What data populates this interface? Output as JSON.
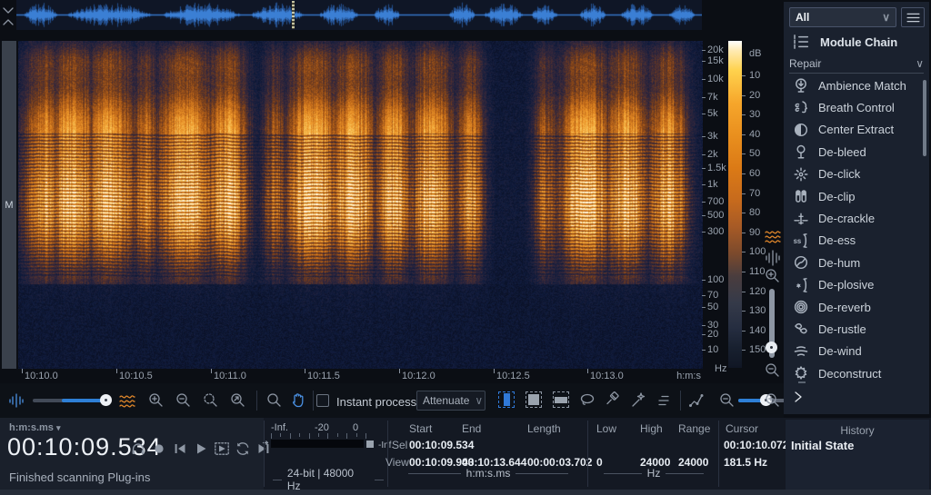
{
  "colors": {
    "accent_blue": "#3079d8",
    "spectrogram_orange": "#e0872b",
    "waveform_blue": "#2f6fc4"
  },
  "sidebar": {
    "filter_value": "All",
    "module_chain_label": "Module Chain",
    "section_label": "Repair",
    "modules": [
      {
        "icon": "ambience-match-icon",
        "label": "Ambience Match"
      },
      {
        "icon": "breath-control-icon",
        "label": "Breath Control"
      },
      {
        "icon": "center-extract-icon",
        "label": "Center Extract"
      },
      {
        "icon": "de-bleed-icon",
        "label": "De-bleed"
      },
      {
        "icon": "de-click-icon",
        "label": "De-click"
      },
      {
        "icon": "de-clip-icon",
        "label": "De-clip"
      },
      {
        "icon": "de-crackle-icon",
        "label": "De-crackle"
      },
      {
        "icon": "de-ess-icon",
        "label": "De-ess"
      },
      {
        "icon": "de-hum-icon",
        "label": "De-hum"
      },
      {
        "icon": "de-plosive-icon",
        "label": "De-plosive"
      },
      {
        "icon": "de-reverb-icon",
        "label": "De-reverb"
      },
      {
        "icon": "de-rustle-icon",
        "label": "De-rustle"
      },
      {
        "icon": "de-wind-icon",
        "label": "De-wind"
      },
      {
        "icon": "deconstruct-icon",
        "label": "Deconstruct"
      }
    ]
  },
  "spectrogram": {
    "channel_label": "M",
    "freq_ticks": [
      "20k",
      "15k",
      "10k",
      "7k",
      "5k",
      "3k",
      "2k",
      "1.5k",
      "1k",
      "700",
      "500",
      "300",
      "100",
      "70",
      "50",
      "30",
      "20",
      "10"
    ],
    "freq_unit": "Hz",
    "db_unit": "dB",
    "db_ticks": [
      "10",
      "20",
      "30",
      "40",
      "50",
      "60",
      "70",
      "80",
      "90",
      "100",
      "110",
      "120",
      "130",
      "140",
      "150"
    ],
    "time_ticks": [
      "10:10.0",
      "10:10.5",
      "10:11.0",
      "10:11.5",
      "10:12.0",
      "10:12.5",
      "10:13.0"
    ],
    "time_unit": "h:m:s"
  },
  "toolbar": {
    "instant_process_label": "Instant process",
    "process_mode": "Attenuate"
  },
  "transport": {
    "time_format": "h:m:s.ms",
    "current_time": "00:10:09.534",
    "status": "Finished scanning Plug-ins"
  },
  "meter": {
    "left_label": "-Inf.",
    "tick_minus20": "-20",
    "tick_zero": "0",
    "clip_value": "-Inf.",
    "format": "24-bit | 48000 Hz"
  },
  "selection": {
    "headers": {
      "start": "Start",
      "end": "End",
      "length": "Length"
    },
    "rows": [
      {
        "label": "Sel",
        "start": "00:10:09.534",
        "end": "",
        "length": ""
      },
      {
        "label": "View",
        "start": "00:10:09.943",
        "end": "00:10:13.644",
        "length": "00:00:03.702"
      }
    ],
    "unit": "h:m:s.ms"
  },
  "frequency_range": {
    "headers": {
      "low": "Low",
      "high": "High",
      "range": "Range"
    },
    "values": {
      "low": "0",
      "high": "24000",
      "range": "24000"
    },
    "unit": "Hz"
  },
  "cursor": {
    "label": "Cursor",
    "time": "00:10:10.072",
    "freq": "181.5 Hz"
  },
  "history": {
    "title": "History",
    "items": [
      "Initial State"
    ]
  }
}
